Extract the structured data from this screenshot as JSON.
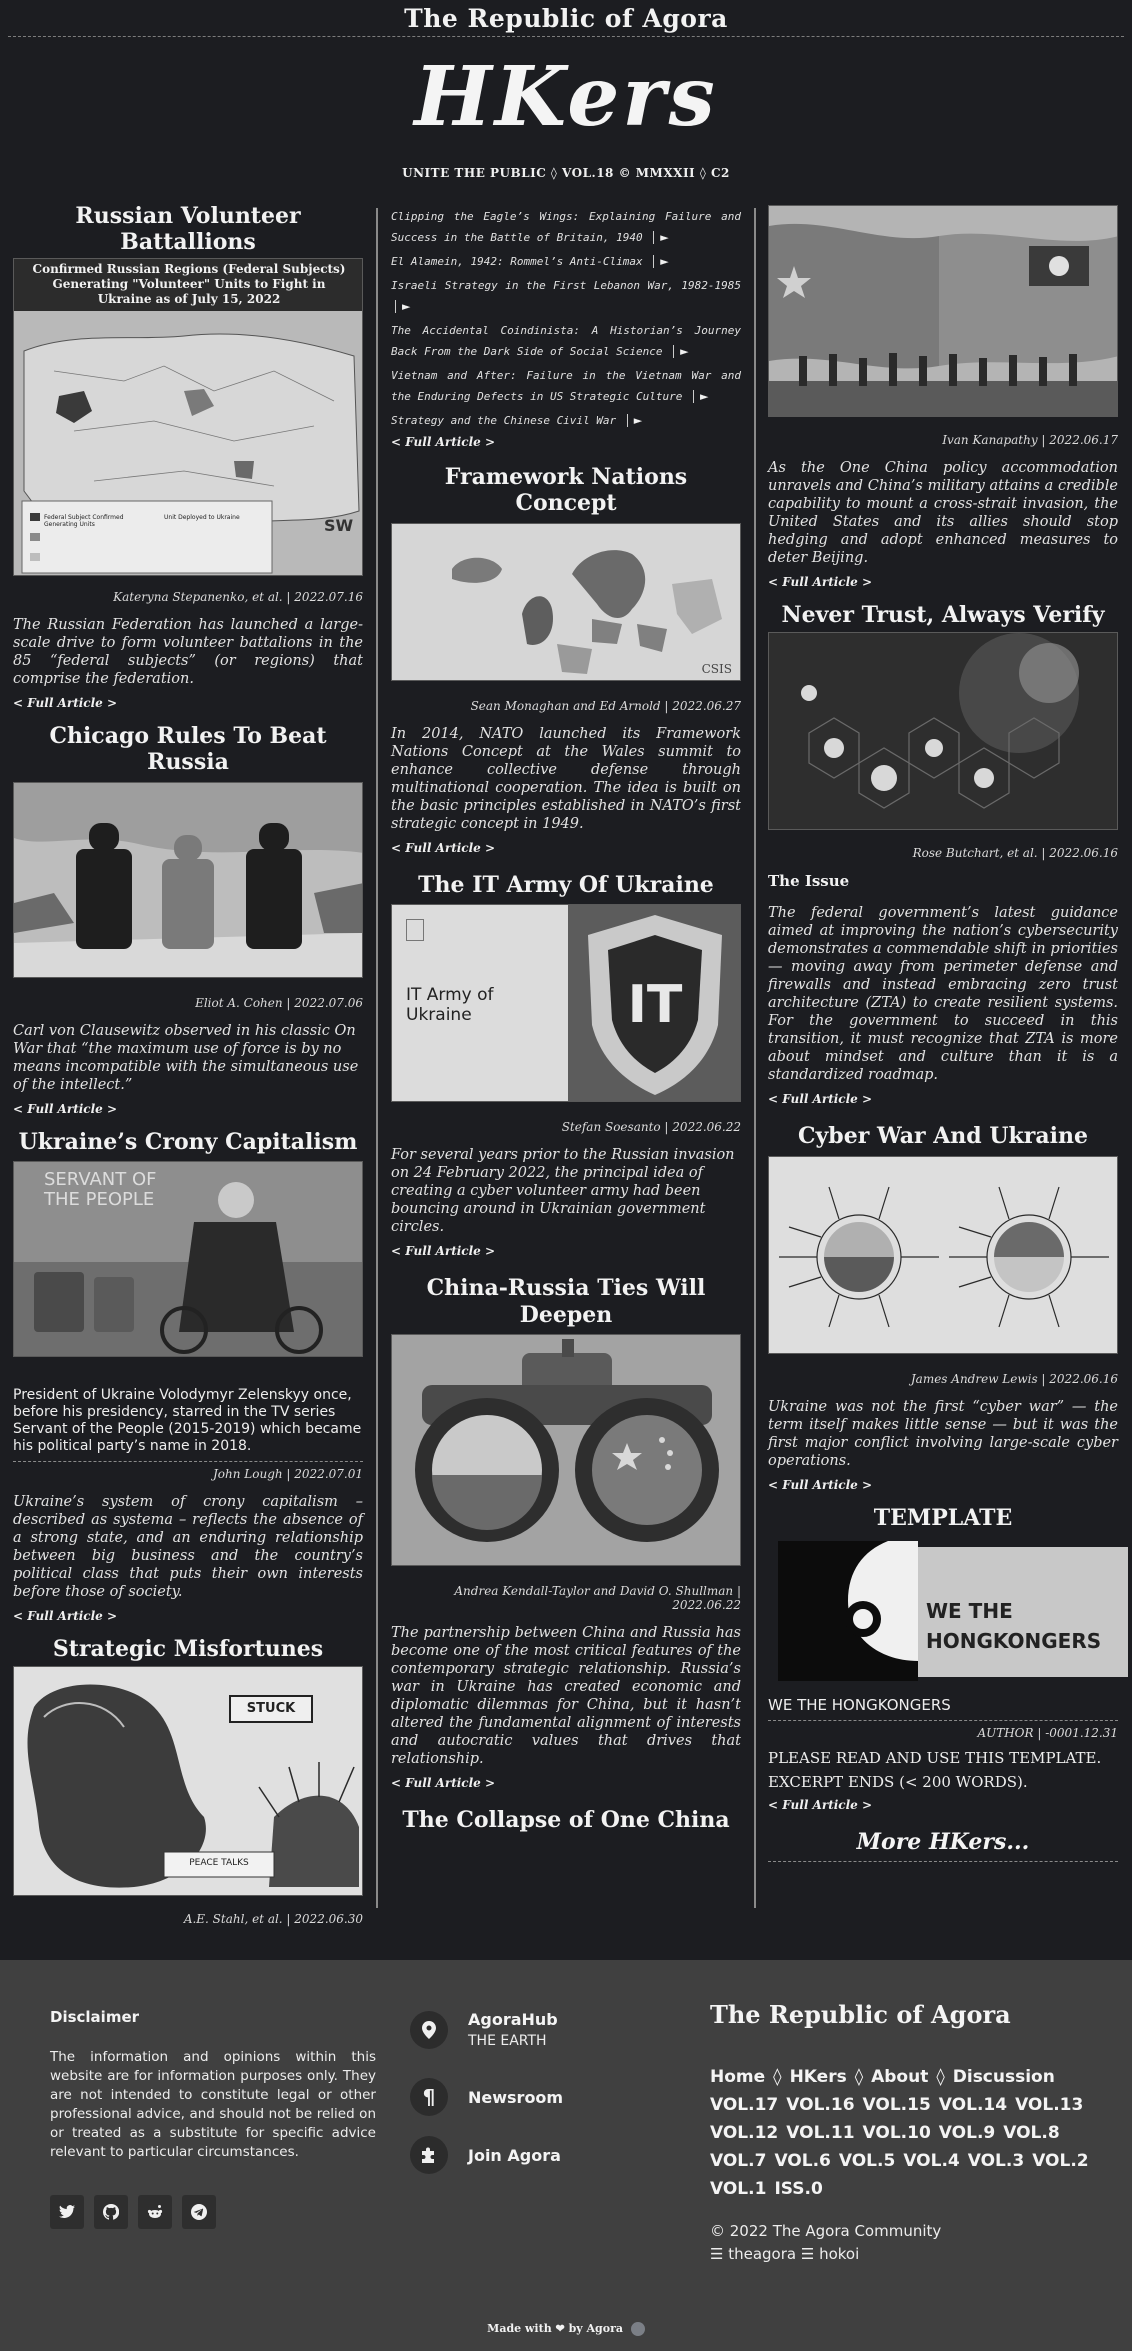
{
  "header": {
    "site_title": "The Republic of Agora",
    "brand": "HKers",
    "issue_line": "UNITE THE PUBLIC ◊ VOL.18 © MMXXII ◊ C2"
  },
  "col1": {
    "a1": {
      "title": "Russian Volunteer Battallions",
      "map_title": "Confirmed Russian Regions (Federal Subjects) Generating \"Volunteer\" Units to Fight in Ukraine as of July 15, 2022",
      "legend1": "Federal Subject Confirmed Generating Units",
      "legend2": "Unit Deployed to Ukraine",
      "byline": "Kateryna Stepanenko, et al. | 2022.07.16",
      "excerpt": "The Russian Federation has launched a large-scale drive to form volunteer battalions in the 85 “federal subjects” (or regions) that comprise the federation.",
      "more": "< Full Article >"
    },
    "a2": {
      "title": "Chicago Rules To Beat Russia",
      "byline": "Eliot A. Cohen | 2022.07.06",
      "excerpt": "Carl von Clausewitz observed in his classic On War that “the maximum use of force is by no means incompatible with the simultaneous use of the intellect.”",
      "more": "< Full Article >"
    },
    "a3": {
      "title": "Ukraine’s Crony Capitalism",
      "image_caption": "SERVANT OF THE PEOPLE",
      "caption": "President of Ukraine Volodymyr Zelenskyy once, before his presidency, starred in the TV series Servant of the People (2015-2019) which became his political party’s name in 2018.",
      "byline": "John Lough | 2022.07.01",
      "excerpt": "Ukraine’s system of crony capitalism – described as systema – reflects the absence of a strong state, and an enduring relationship between big business and the country’s political class that puts their own interests before those of society.",
      "more": "< Full Article >"
    },
    "a4": {
      "title": "Strategic Misfortunes",
      "sign": "STUCK",
      "sign2": "PEACE TALKS",
      "byline": "A.E. Stahl, et al. | 2022.06.30"
    }
  },
  "col2": {
    "related": [
      "Clipping the Eagle’s Wings: Explaining Failure and Success in the Battle of Britain, 1940",
      "El Alamein, 1942: Rommel’s Anti-Climax",
      "Israeli Strategy in the First Lebanon War, 1982-1985",
      "The Accidental Coindinista: A Historian’s Journey Back From the Dark Side of Social Science",
      "Vietnam and After: Failure in the Vietnam War and the Enduring Defects in US Strategic Culture",
      "Strategy and the Chinese Civil War"
    ],
    "arrow": "►",
    "related_more": "< Full Article >",
    "b1": {
      "title": "Framework Nations Concept",
      "map_logo": "CSIS",
      "byline": "Sean Monaghan and Ed Arnold | 2022.06.27",
      "excerpt": "In 2014, NATO launched its Framework Nations Concept at the Wales summit to enhance collective defense through multinational cooperation. The idea is built on the basic principles established in NATO’s first strategic concept in 1949.",
      "more": "< Full Article >"
    },
    "b2": {
      "title": "The IT Army Of Ukraine",
      "image_text": "IT Army of Ukraine",
      "badge": "IT",
      "byline": "Stefan Soesanto | 2022.06.22",
      "excerpt": "For several years prior to the Russian invasion on 24 February 2022, the principal idea of creating a cyber volunteer army had been bouncing around in Ukrainian government circles.",
      "more": "< Full Article >"
    },
    "b3": {
      "title": "China-Russia Ties Will Deepen",
      "byline": "Andrea Kendall-Taylor and David O. Shullman | 2022.06.22",
      "excerpt": "The partnership between China and Russia has become one of the most critical features of the contemporary strategic relationship. Russia’s war in Ukraine has created economic and diplomatic dilemmas for China, but it hasn’t altered the fundamental alignment of interests and autocratic values that drives that relationship.",
      "more": "< Full Article >"
    },
    "b4": {
      "title": "The Collapse of One China"
    }
  },
  "col3": {
    "c1": {
      "byline": "Ivan Kanapathy | 2022.06.17",
      "excerpt": "As the One China policy accommodation unravels and China’s military attains a credible capability to mount a cross-strait invasion, the United States and its allies should stop hedging and adopt enhanced measures to deter Beijing.",
      "more": "< Full Article >"
    },
    "c2": {
      "title": "Never Trust, Always Verify",
      "byline": "Rose Butchart, et al. | 2022.06.16",
      "subhead": "The Issue",
      "excerpt": "The federal government’s latest guidance aimed at improving the nation’s cybersecurity demonstrates a commendable shift in priorities — moving away from perimeter defense and firewalls and instead embracing zero trust architecture (ZTA) to create resilient systems. For the government to succeed in this transition, it must recognize that ZTA is more about mindset and culture than it is a standardized roadmap.",
      "more": "< Full Article >"
    },
    "c3": {
      "title": "Cyber War And Ukraine",
      "byline": "James Andrew Lewis | 2022.06.16",
      "excerpt": "Ukraine was not the first “cyber war” — the term itself makes little sense — but it was the first major conflict involving large-scale cyber operations.",
      "more": "< Full Article >"
    },
    "c4": {
      "title": "TEMPLATE",
      "logo_line1": "WE THE",
      "logo_line2": "HONGKONGERS",
      "caption": "WE THE HONGKONGERS",
      "byline": "AUTHOR | -0001.12.31",
      "line1": "PLEASE READ AND USE THIS TEMPLATE.",
      "line2": "EXCERPT ENDS (< 200 WORDS).",
      "more": "< Full Article >"
    },
    "more_hkers": "More HKers..."
  },
  "footer": {
    "disclaimer_title": "Disclaimer",
    "disclaimer_body": "The information and opinions within this website are for information purposes only. They are not intended to constitute legal or other professional advice, and should not be relied on or treated as a substitute for specific advice relevant to particular circumstances.",
    "social": [
      "twitter-icon",
      "github-icon",
      "reddit-icon",
      "telegram-icon"
    ],
    "contact1_label": "AgoraHub",
    "contact1_sub": "THE EARTH",
    "contact2_label": "Newsroom",
    "contact3_label": "Join Agora",
    "brand": "The Republic of Agora",
    "nav": [
      "Home",
      "◊",
      "HKers",
      "◊",
      "About",
      "◊",
      "Discussion"
    ],
    "vols": [
      "VOL.17",
      "VOL.16",
      "VOL.15",
      "VOL.14",
      "VOL.13",
      "VOL.12",
      "VOL.11",
      "VOL.10",
      "VOL.9",
      "VOL.8",
      "VOL.7",
      "VOL.6",
      "VOL.5",
      "VOL.4",
      "VOL.3",
      "VOL.2",
      "VOL.1",
      "ISS.0"
    ],
    "copyright": "© 2022 The Agora Community",
    "handles": "☰ theagora ☰ hokoi",
    "made_with_prefix": "Made with",
    "made_with_suffix": "by Agora"
  }
}
